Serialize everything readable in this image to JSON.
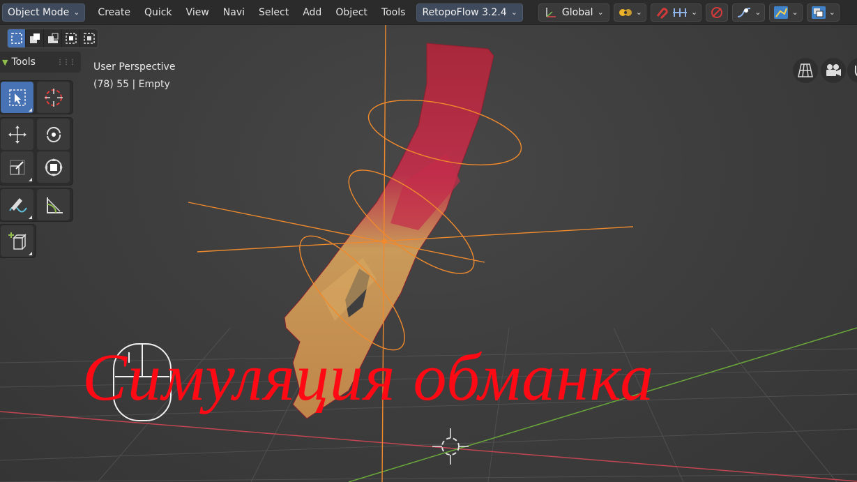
{
  "header": {
    "mode_dropdown": "Object Mode",
    "menus": [
      "Create",
      "Quick",
      "View",
      "Navi",
      "Select",
      "Add",
      "Object",
      "Tools"
    ],
    "addon_dropdown": "RetopoFlow 3.2.4",
    "orientation_dropdown": "Global"
  },
  "toolbar": {
    "title": "Tools",
    "tools": [
      {
        "name": "select-box",
        "icon": "select-box-icon",
        "active": true
      },
      {
        "name": "cursor",
        "icon": "cursor-icon",
        "active": false
      },
      {
        "name": "move",
        "icon": "move-icon",
        "active": false
      },
      {
        "name": "rotate",
        "icon": "rotate-icon",
        "active": false
      },
      {
        "name": "scale",
        "icon": "scale-icon",
        "active": false
      },
      {
        "name": "transform",
        "icon": "transform-icon",
        "active": false
      },
      {
        "name": "annotate",
        "icon": "annotate-icon",
        "active": false
      },
      {
        "name": "measure",
        "icon": "measure-icon",
        "active": false
      },
      {
        "name": "add-cube",
        "icon": "add-cube-icon",
        "active": false
      }
    ]
  },
  "viewport": {
    "perspective": "User Perspective",
    "object_info": "(78) 55 | Empty",
    "colors": {
      "accent": "#4772b3",
      "selection_orange": "#f08a2c",
      "x_axis": "#c24552",
      "y_axis": "#6aa83a"
    }
  },
  "overlay": {
    "title": "Симуляция обманка",
    "color": "#ff0a14"
  }
}
